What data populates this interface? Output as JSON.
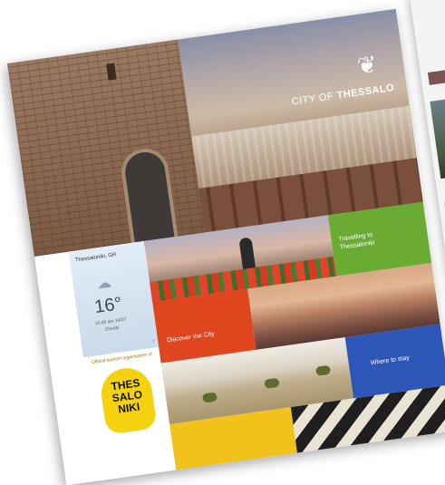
{
  "site": {
    "brand_prefix": "CITY OF",
    "brand_name": "THESSALO",
    "logo_icon": "lion-head-logo"
  },
  "weather": {
    "location": "Thessaloniki, GR",
    "temperature": "16°",
    "time": "10:45 am 19/07",
    "condition": "Cloudy",
    "ad_marker": "x"
  },
  "promo": {
    "small_text": "Official tourism organisation of",
    "lines": [
      "THES",
      "SALO",
      "NIKI"
    ]
  },
  "tiles": {
    "travelling": "Travelling to Thessaloniki",
    "discover": "Discover the City",
    "where_to_stay": "Where to stay"
  }
}
